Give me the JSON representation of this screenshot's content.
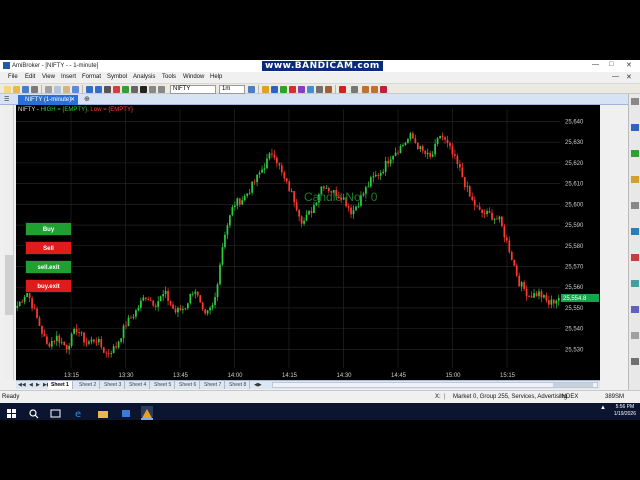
{
  "app_title": "AmiBroker - [NIFTY - - 1-minute]",
  "watermark": "www.BANDICAM.com",
  "menu": [
    "File",
    "Edit",
    "View",
    "Insert",
    "Format",
    "Symbol",
    "Analysis",
    "Tools",
    "Window",
    "Help"
  ],
  "toolbar": {
    "symbol": "NIFTY",
    "interval": "1m"
  },
  "chart_tab": {
    "label": "NIFTY (1-minute)"
  },
  "chart_caption": {
    "prefix": "NIFTY - ",
    "high": "HIGH = {EMPTY}, ",
    "low": "Low = {EMPTY}"
  },
  "buttons": {
    "buy": "Buy",
    "sell": "Sell",
    "sell_exit": "sell.exit",
    "buy_exit": "buy.exit"
  },
  "candle_label": "Candle No : 0",
  "sheets": [
    "Sheet 1",
    "Sheet 2",
    "Sheet 3",
    "Sheet 4",
    "Sheet 5",
    "Sheet 6",
    "Sheet 7",
    "Sheet 8"
  ],
  "status": {
    "ready": "Ready",
    "x_label": "X:",
    "market_info": "Market 0, Group 255, Services, Advertising",
    "index": "INDEX",
    "memory": "389SM",
    "time": "5:56 PM",
    "date": "1/19/2026"
  },
  "colors": {
    "up": "#2ecc40",
    "down": "#ff3b30",
    "grid": "#2a2a2a",
    "buy": "#20a030",
    "sell": "#e01b1b",
    "last_price": "#1aa34a"
  },
  "chart_data": {
    "type": "candlestick",
    "title": "NIFTY (1-minute)",
    "y_ticks": [
      25530,
      25540,
      25550,
      25560,
      25570,
      25580,
      25590,
      25600,
      25610,
      25620,
      25630,
      25640
    ],
    "ylim": [
      25521,
      25646
    ],
    "x_ticks": [
      "13:15",
      "13:30",
      "13:45",
      "14:00",
      "14:15",
      "14:30",
      "14:45",
      "15:00",
      "15:15"
    ],
    "last_price": "25,554.8",
    "close_path": [
      25551,
      25558,
      25545,
      25532,
      25536,
      25531,
      25540,
      25533,
      25535,
      25528,
      25531,
      25542,
      25548,
      25556,
      25552,
      25557,
      25548,
      25550,
      25560,
      25545,
      25552,
      25585,
      25600,
      25603,
      25610,
      25618,
      25626,
      25613,
      25604,
      25591,
      25598,
      25610,
      25606,
      25604,
      25596,
      25604,
      25612,
      25616,
      25624,
      25628,
      25633,
      25626,
      25622,
      25634,
      25626,
      25616,
      25603,
      25596,
      25595,
      25592,
      25578,
      25562,
      25556,
      25557,
      25552,
      25554.8
    ]
  }
}
